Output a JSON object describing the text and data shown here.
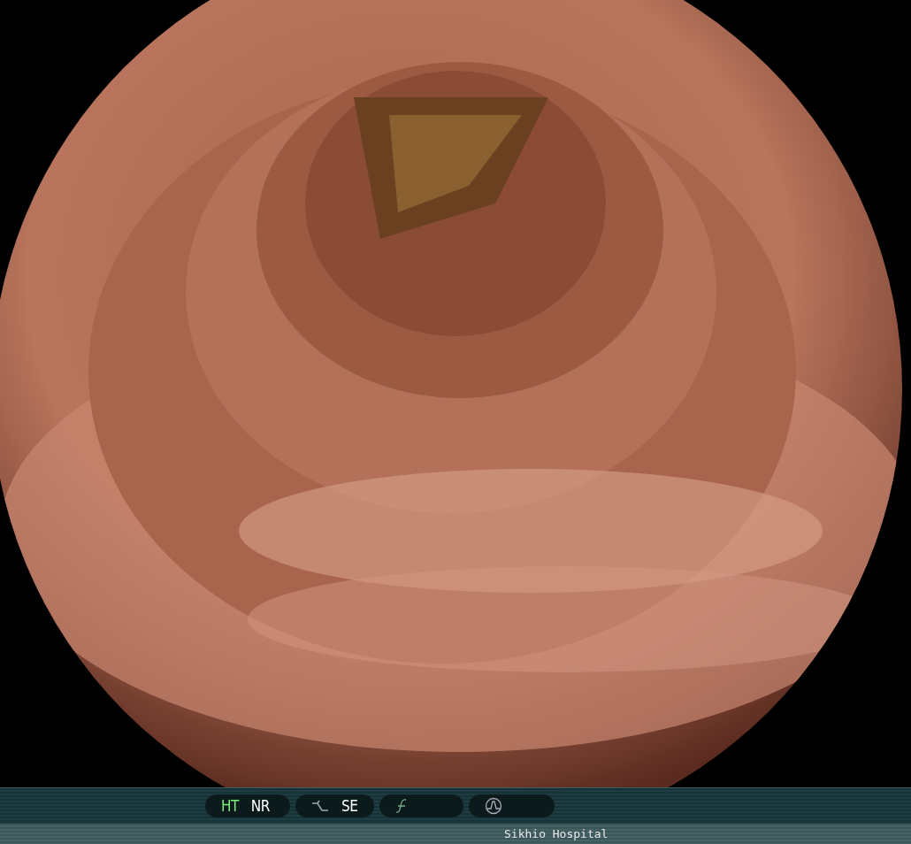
{
  "status_bar": {
    "groups": [
      {
        "kind": "modes",
        "items": [
          {
            "label": "HT",
            "on": true
          },
          {
            "label": "NR",
            "on": false
          }
        ]
      },
      {
        "kind": "curve",
        "label": "SE"
      },
      {
        "kind": "function"
      },
      {
        "kind": "wave"
      }
    ]
  },
  "footer": {
    "hospital": "Sikhio Hospital"
  }
}
